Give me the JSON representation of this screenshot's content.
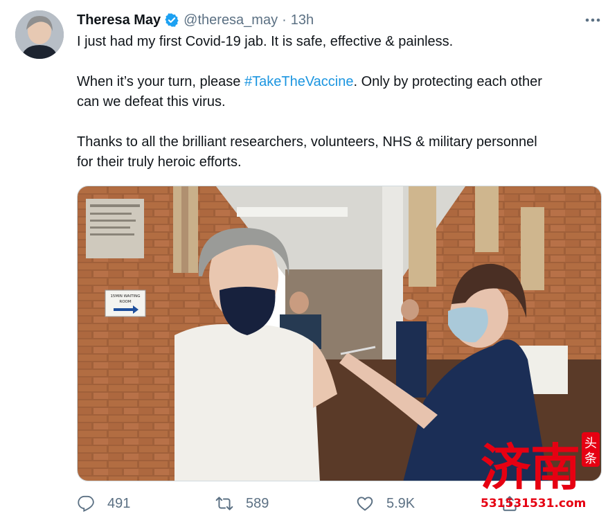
{
  "tweet": {
    "author_name": "Theresa May",
    "handle": "@theresa_may",
    "separator": "·",
    "time": "13h",
    "lines": [
      "I just had my first Covid-19 jab. It is safe, effective & painless."
    ],
    "para2_before": "When it’s your turn, please ",
    "para2_hashtag": "#TakeTheVaccine",
    "para2_after": ". Only by protecting each other",
    "para2_line2": "can we defeat this virus.",
    "para3_line1": "Thanks to all the brilliant researchers, volunteers, NHS & military personnel",
    "para3_line2": "for their truly heroic efforts."
  },
  "photo_sign": {
    "line1": "15MIN WAITING",
    "line2": "ROOM"
  },
  "actions": {
    "replies": "491",
    "retweets": "589",
    "likes": "5.9K"
  },
  "watermark": {
    "characters": "济南",
    "badge": "头条",
    "site": "531531531.com"
  },
  "colors": {
    "text": "#0f1419",
    "secondary": "#5b7083",
    "link": "#1b95e0",
    "verified": "#1da1f2",
    "watermark": "#e60012"
  },
  "icons": [
    "verified-badge-icon",
    "more-options-icon",
    "reply-icon",
    "retweet-icon",
    "like-icon",
    "share-icon"
  ]
}
